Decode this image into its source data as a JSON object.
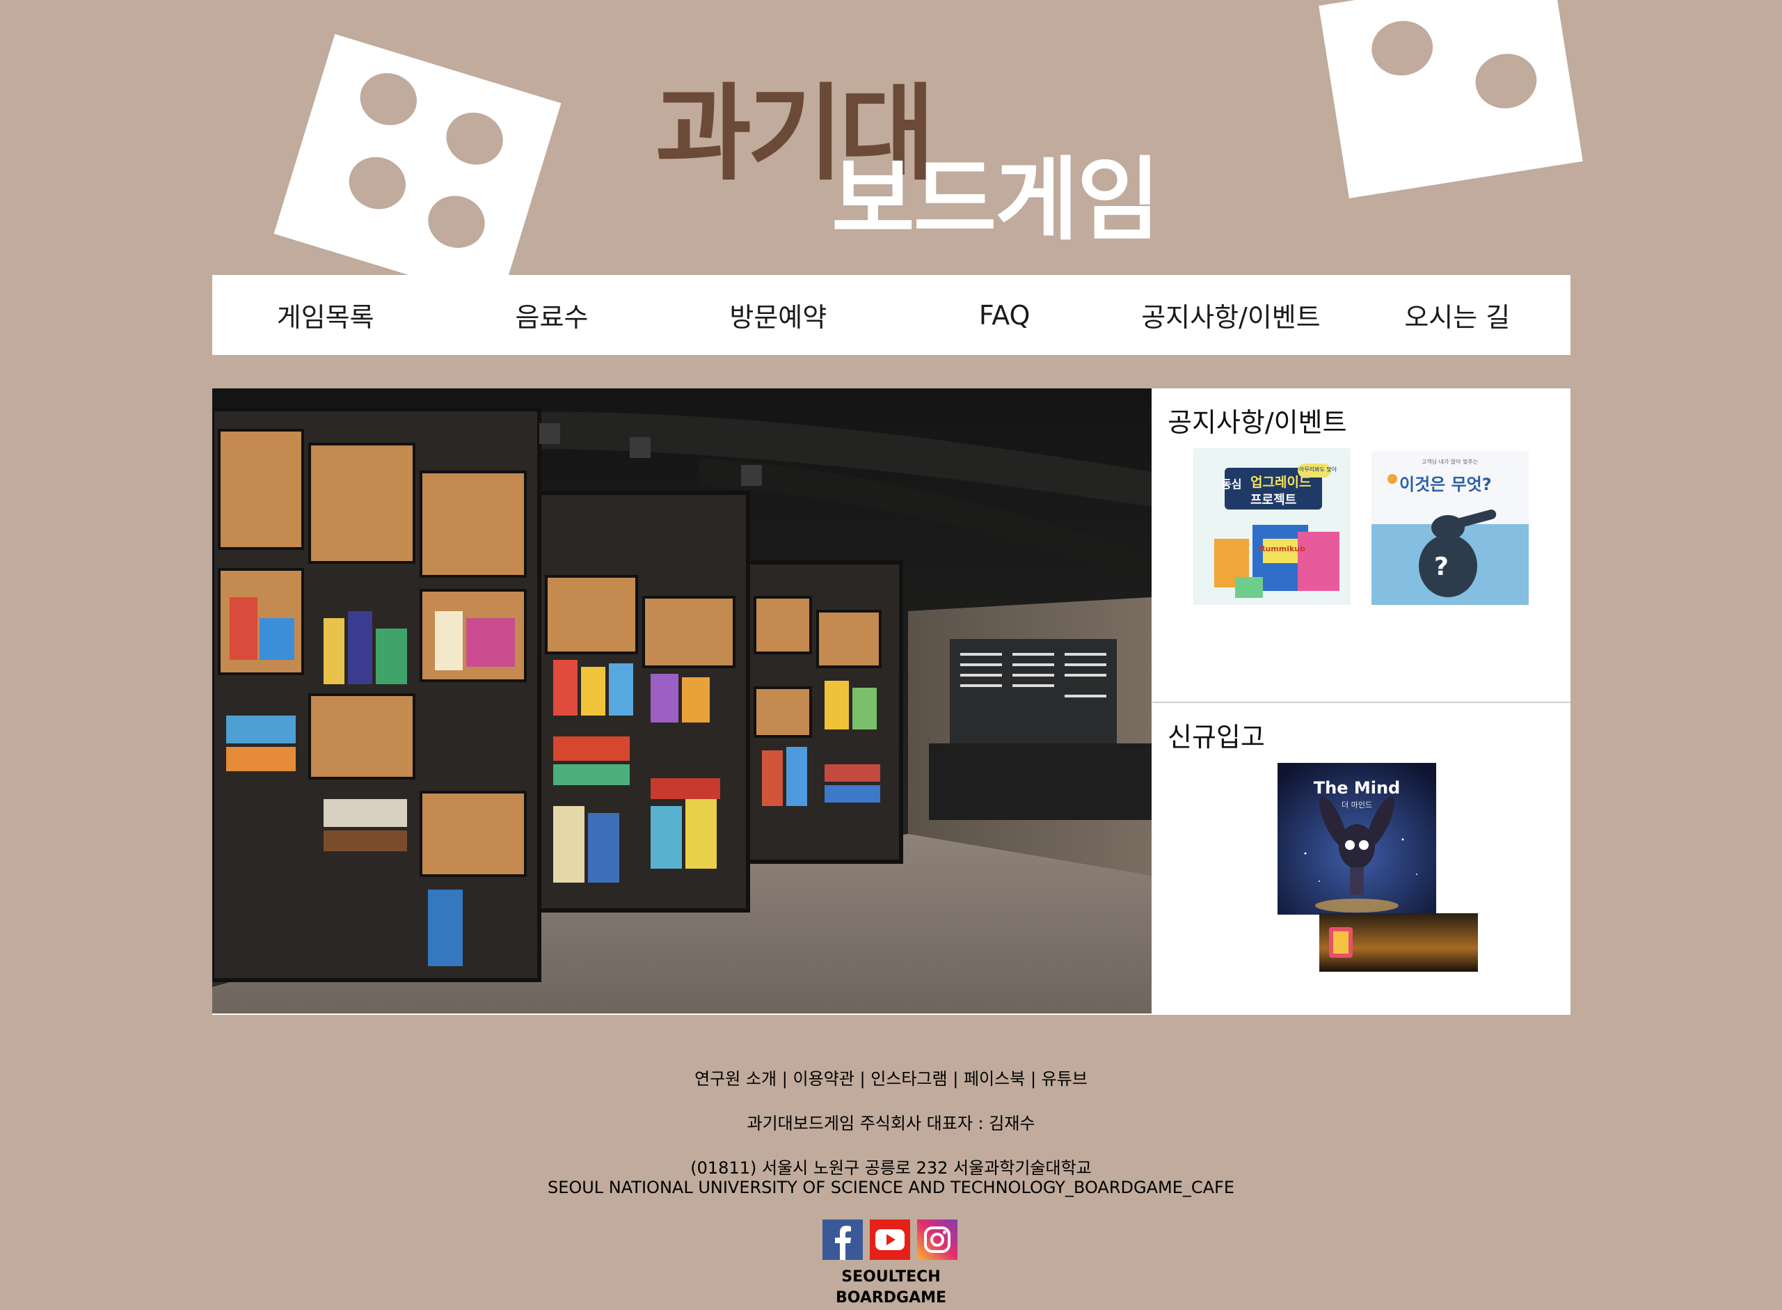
{
  "logo": {
    "line1": "과기대",
    "line2": "보드게임"
  },
  "nav": {
    "items": [
      {
        "label": "게임목록"
      },
      {
        "label": "음료수"
      },
      {
        "label": "방문예약"
      },
      {
        "label": "FAQ"
      },
      {
        "label": "공지사항/이벤트"
      },
      {
        "label": "오시는 길"
      }
    ]
  },
  "notice": {
    "title": "공지사항/이벤트",
    "cards": [
      {
        "text_small": "아무리봐도 맞아",
        "text_main1": "동심",
        "text_main2": "업그레이드",
        "text_main3": "프로젝트",
        "product": "Rummikub"
      },
      {
        "text_small": "고객님 내가 알아 맞추는",
        "text_main": "이것은 무엇?",
        "symbol": "?"
      }
    ]
  },
  "new_arrival": {
    "title": "신규입고",
    "product_title": "The Mind",
    "product_sub": "더 마인드"
  },
  "footer": {
    "links": [
      "연구원 소개",
      "이용약관",
      "인스타그램",
      "페이스북",
      "유튜브"
    ],
    "separator": "|",
    "company": "과기대보드게임 주식회사 대표자 : 김재수",
    "address_kr": "(01811) 서울시 노원구 공릉로 232 서울과학기술대학교",
    "address_en": "SEOUL NATIONAL UNIVERSITY OF SCIENCE AND TECHNOLOGY_BOARDGAME_CAFE",
    "social": [
      "facebook-icon",
      "youtube-icon",
      "instagram-icon"
    ],
    "brand_line1": "SEOULTECH",
    "brand_line2": "BOARDGAME"
  },
  "colors": {
    "background": "#c0ab9c",
    "logo_brown": "#6b4a38",
    "white": "#ffffff"
  }
}
